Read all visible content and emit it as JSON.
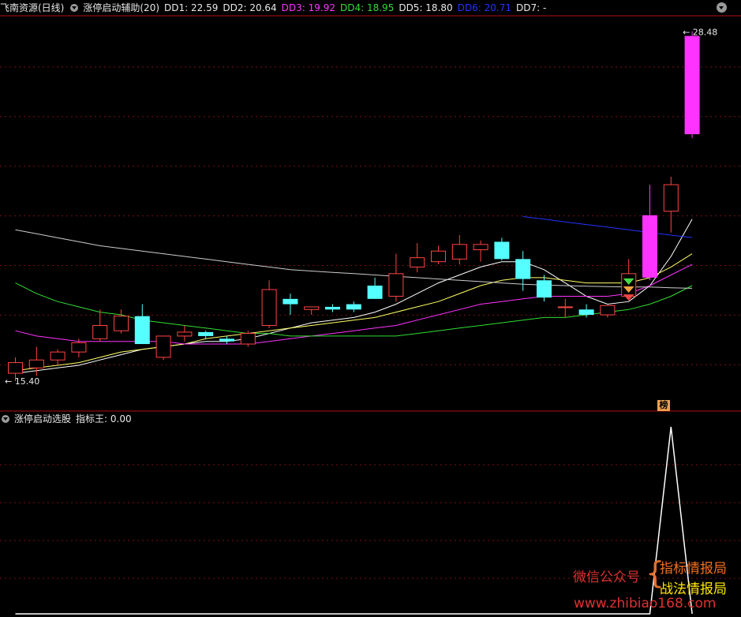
{
  "main_header": {
    "stock": "飞南资源(日线)",
    "indicator": "涨停启动辅助(20)",
    "dd": [
      {
        "label": "DD1: 22.59",
        "color": "#e8e8e8"
      },
      {
        "label": "DD2: 20.64",
        "color": "#e8e8e8"
      },
      {
        "label": "DD3: 19.92",
        "color": "#ff33ff"
      },
      {
        "label": "DD4: 18.95",
        "color": "#33dd33"
      },
      {
        "label": "DD5: 18.80",
        "color": "#e8e8e8"
      },
      {
        "label": "DD6: 20.71",
        "color": "#2233ff"
      },
      {
        "label": "DD7: -",
        "color": "#e8e8e8"
      }
    ]
  },
  "sub_header": {
    "title": "涨停启动选股",
    "value": "指标王: 0.00"
  },
  "labels": {
    "max_price": "28.48",
    "min_price": "15.40",
    "bang": "榜"
  },
  "watermark": {
    "left": "微信公众号",
    "right1": "指标情报局",
    "right2": "战法情报局",
    "url": "www.zhibiao168.com"
  },
  "chart_data": {
    "type": "candlestick",
    "price_scale": {
      "ymin": 14.8,
      "ymax": 29.0
    },
    "candles": [
      {
        "o": 15.6,
        "h": 16.2,
        "l": 15.3,
        "c": 16.0
      },
      {
        "o": 15.8,
        "h": 16.6,
        "l": 15.5,
        "c": 16.1
      },
      {
        "o": 16.1,
        "h": 16.5,
        "l": 15.9,
        "c": 16.4
      },
      {
        "o": 16.4,
        "h": 16.9,
        "l": 16.2,
        "c": 16.75
      },
      {
        "o": 16.9,
        "h": 18.0,
        "l": 16.8,
        "c": 17.4
      },
      {
        "o": 17.2,
        "h": 18.0,
        "l": 17.1,
        "c": 17.75
      },
      {
        "o": 17.75,
        "h": 18.2,
        "l": 16.8,
        "c": 16.7
      },
      {
        "o": 16.2,
        "h": 17.0,
        "l": 16.1,
        "c": 17.0
      },
      {
        "o": 17.0,
        "h": 17.4,
        "l": 16.8,
        "c": 17.15
      },
      {
        "o": 17.15,
        "h": 17.2,
        "l": 16.9,
        "c": 17.0
      },
      {
        "o": 16.9,
        "h": 17.0,
        "l": 16.7,
        "c": 16.8
      },
      {
        "o": 16.7,
        "h": 17.2,
        "l": 16.6,
        "c": 17.1
      },
      {
        "o": 17.4,
        "h": 19.1,
        "l": 17.3,
        "c": 18.75
      },
      {
        "o": 18.4,
        "h": 18.6,
        "l": 17.8,
        "c": 18.2
      },
      {
        "o": 18.0,
        "h": 18.1,
        "l": 17.8,
        "c": 18.1
      },
      {
        "o": 18.1,
        "h": 18.2,
        "l": 17.9,
        "c": 18.0
      },
      {
        "o": 18.2,
        "h": 18.3,
        "l": 17.9,
        "c": 18.0
      },
      {
        "o": 18.9,
        "h": 19.2,
        "l": 18.4,
        "c": 18.4
      },
      {
        "o": 18.5,
        "h": 20.1,
        "l": 18.3,
        "c": 19.35
      },
      {
        "o": 19.6,
        "h": 20.5,
        "l": 19.4,
        "c": 19.95
      },
      {
        "o": 19.8,
        "h": 20.4,
        "l": 19.7,
        "c": 20.2
      },
      {
        "o": 19.9,
        "h": 20.8,
        "l": 19.7,
        "c": 20.45
      },
      {
        "o": 20.25,
        "h": 20.6,
        "l": 19.8,
        "c": 20.45
      },
      {
        "o": 20.55,
        "h": 20.7,
        "l": 19.85,
        "c": 19.9
      },
      {
        "o": 19.9,
        "h": 20.2,
        "l": 18.7,
        "c": 19.15
      },
      {
        "o": 19.1,
        "h": 19.3,
        "l": 18.3,
        "c": 18.45
      },
      {
        "o": 18.1,
        "h": 18.4,
        "l": 17.7,
        "c": 18.1
      },
      {
        "o": 18.0,
        "h": 18.2,
        "l": 17.7,
        "c": 17.8
      },
      {
        "o": 17.8,
        "h": 18.15,
        "l": 17.7,
        "c": 18.15
      },
      {
        "o": 18.5,
        "h": 19.9,
        "l": 18.4,
        "c": 19.35
      },
      {
        "o": 19.2,
        "h": 22.7,
        "l": 19.1,
        "c": 21.55
      },
      {
        "o": 21.7,
        "h": 23.0,
        "l": 20.9,
        "c": 22.7
      },
      {
        "o": 24.6,
        "h": 28.48,
        "l": 24.45,
        "c": 28.3
      }
    ],
    "ma_lines": [
      {
        "color": "#ffffff",
        "values": [
          15.6,
          15.7,
          15.8,
          15.9,
          16.1,
          16.3,
          16.5,
          16.6,
          16.7,
          16.8,
          16.8,
          16.9,
          17.1,
          17.3,
          17.5,
          17.6,
          17.7,
          17.9,
          18.2,
          18.6,
          19.0,
          19.3,
          19.6,
          19.8,
          19.8,
          19.5,
          19.0,
          18.5,
          18.2,
          18.3,
          18.9,
          20.0,
          21.4
        ]
      },
      {
        "color": "#ffff66",
        "values": [
          15.7,
          15.8,
          15.9,
          16.0,
          16.2,
          16.4,
          16.5,
          16.6,
          16.7,
          16.9,
          17.0,
          17.1,
          17.2,
          17.3,
          17.4,
          17.5,
          17.6,
          17.7,
          17.9,
          18.1,
          18.3,
          18.6,
          18.9,
          19.1,
          19.2,
          19.2,
          19.1,
          19.0,
          19.0,
          19.0,
          19.2,
          19.6,
          20.1
        ]
      },
      {
        "color": "#ff33ff",
        "values": [
          17.2,
          17.0,
          16.9,
          16.8,
          16.8,
          16.8,
          16.8,
          16.8,
          16.7,
          16.7,
          16.7,
          16.7,
          16.8,
          16.9,
          17.0,
          17.1,
          17.2,
          17.3,
          17.4,
          17.6,
          17.8,
          18.0,
          18.2,
          18.3,
          18.4,
          18.5,
          18.5,
          18.5,
          18.5,
          18.6,
          18.9,
          19.3,
          19.7
        ]
      },
      {
        "color": "#33dd33",
        "values": [
          19.0,
          18.6,
          18.3,
          18.1,
          17.9,
          17.8,
          17.6,
          17.5,
          17.4,
          17.3,
          17.2,
          17.1,
          17.1,
          17.0,
          17.0,
          17.0,
          17.0,
          17.0,
          17.0,
          17.1,
          17.2,
          17.3,
          17.4,
          17.5,
          17.6,
          17.7,
          17.7,
          17.8,
          17.9,
          18.0,
          18.2,
          18.5,
          18.9
        ]
      },
      {
        "color": "#cccccc",
        "values": [
          21.0,
          20.85,
          20.7,
          20.55,
          20.4,
          20.3,
          20.2,
          20.1,
          20.0,
          19.9,
          19.8,
          19.7,
          19.6,
          19.5,
          19.45,
          19.4,
          19.35,
          19.3,
          19.25,
          19.2,
          19.15,
          19.1,
          19.05,
          19.0,
          18.95,
          18.92,
          18.9,
          18.88,
          18.86,
          18.85,
          18.85,
          18.82,
          18.8
        ]
      },
      {
        "color": "#2233ff",
        "start": 24,
        "values": [
          21.5,
          21.4,
          21.3,
          21.2,
          21.1,
          21.0,
          20.9,
          20.8,
          20.71
        ]
      }
    ],
    "sub_panel": {
      "series": [
        0,
        0,
        0,
        0,
        0,
        0,
        0,
        0,
        0,
        0,
        0,
        0,
        0,
        0,
        0,
        0,
        0,
        0,
        0,
        0,
        0,
        0,
        0,
        0,
        0,
        0,
        0,
        0,
        0,
        0,
        0,
        1,
        0
      ],
      "ymax": 1
    }
  }
}
